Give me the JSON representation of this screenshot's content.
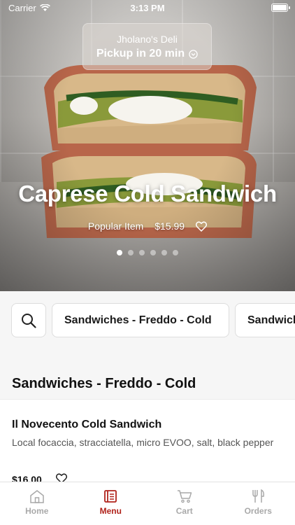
{
  "status_bar": {
    "carrier": "Carrier",
    "time": "3:13 PM"
  },
  "pickup": {
    "store_name": "Jholano's Deli",
    "pickup_time": "Pickup in 20 min"
  },
  "hero": {
    "title": "Caprese Cold Sandwich",
    "tag": "Popular Item",
    "price": "$15.99",
    "carousel": {
      "count": 6,
      "active_index": 0
    }
  },
  "categories": {
    "search_icon": "search-icon",
    "chips": [
      "Sandwiches - Freddo - Cold",
      "Sandwich"
    ]
  },
  "section": {
    "title": "Sandwiches - Freddo - Cold"
  },
  "items": [
    {
      "name": "Il Novecento Cold Sandwich",
      "description": "Local focaccia, stracciatella, micro EVOO, salt, black pepper",
      "price": "$16.00"
    }
  ],
  "tabs": [
    {
      "label": "Home",
      "icon": "home-icon",
      "active": false
    },
    {
      "label": "Menu",
      "icon": "menu-icon",
      "active": true
    },
    {
      "label": "Cart",
      "icon": "cart-icon",
      "active": false
    },
    {
      "label": "Orders",
      "icon": "utensils-icon",
      "active": false
    }
  ],
  "colors": {
    "accent": "#b0231b",
    "inactive_tab": "#a9a9a9"
  }
}
